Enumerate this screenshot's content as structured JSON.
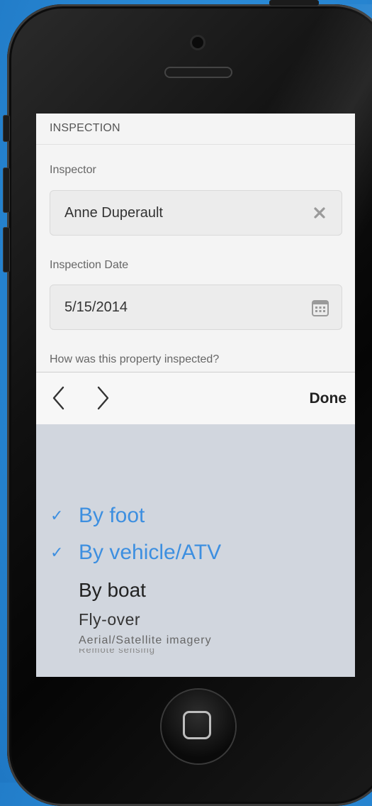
{
  "section": {
    "title": "INSPECTION"
  },
  "inspector": {
    "label": "Inspector",
    "value": "Anne Duperault"
  },
  "date": {
    "label": "Inspection Date",
    "value": "5/15/2014"
  },
  "question": "How was this property inspected?",
  "toolbar": {
    "done_label": "Done"
  },
  "picker": {
    "options": [
      {
        "label": "By foot",
        "checked": true
      },
      {
        "label": "By vehicle/ATV",
        "checked": true
      },
      {
        "label": "By boat",
        "checked": false
      },
      {
        "label": "Fly-over",
        "checked": false
      },
      {
        "label": "Aerial/Satellite imagery",
        "checked": false
      },
      {
        "label": "Remote sensing",
        "checked": false
      }
    ]
  },
  "icons": {
    "clear": "close-icon",
    "calendar": "calendar-icon",
    "prev": "chevron-left-icon",
    "next": "chevron-right-icon",
    "check": "checkmark-icon"
  },
  "colors": {
    "accent": "#3d8fe0",
    "picker_bg": "#d1d6de",
    "background": "#2a8ad6"
  }
}
